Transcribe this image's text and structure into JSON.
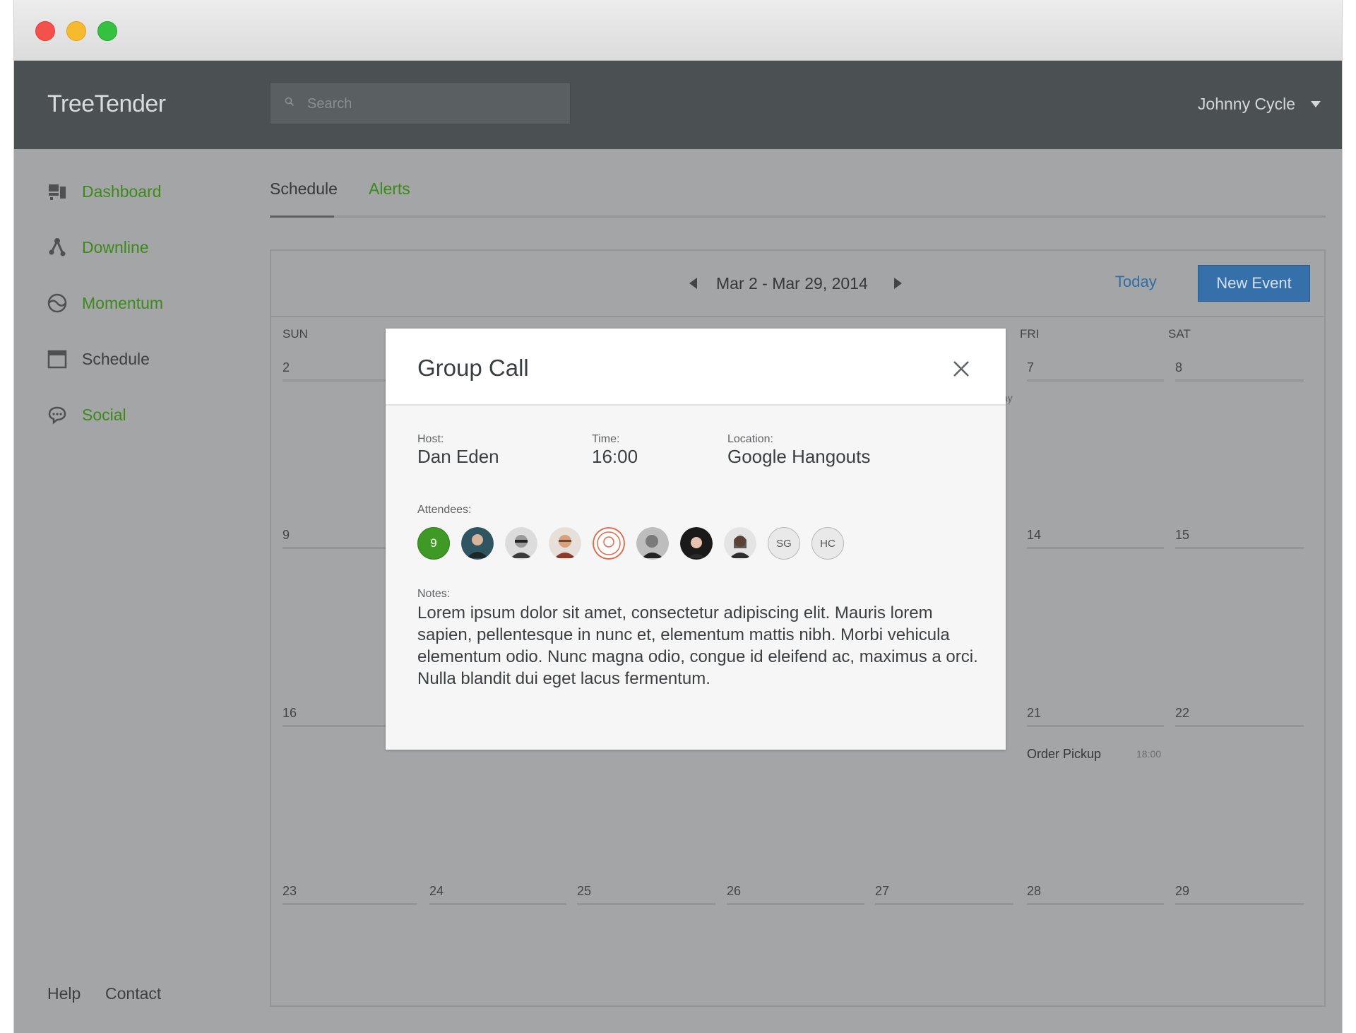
{
  "brand": "TreeTender",
  "search": {
    "placeholder": "Search"
  },
  "user": {
    "name": "Johnny Cycle"
  },
  "sidebar": {
    "items": [
      {
        "label": "Dashboard",
        "icon": "dashboard-icon"
      },
      {
        "label": "Downline",
        "icon": "downline-icon"
      },
      {
        "label": "Momentum",
        "icon": "momentum-icon"
      },
      {
        "label": "Schedule",
        "icon": "calendar-icon",
        "active": true
      },
      {
        "label": "Social",
        "icon": "chat-bubble-icon"
      }
    ],
    "footer": {
      "help": "Help",
      "contact": "Contact"
    }
  },
  "tabs": [
    {
      "label": "Schedule",
      "active": true
    },
    {
      "label": "Alerts",
      "active": false
    }
  ],
  "calendar": {
    "range": "Mar 2 - Mar 29, 2014",
    "today": "Today",
    "new_event": "New Event",
    "days_of_week": [
      "SUN",
      "FRI",
      "SAT"
    ],
    "weeks": [
      [
        "2",
        "7",
        "8"
      ],
      [
        "9",
        "14",
        "15"
      ],
      [
        "16",
        "21",
        "22"
      ],
      [
        "23",
        "24",
        "25",
        "26",
        "27",
        "28",
        "29"
      ]
    ],
    "fragment_text": "l day",
    "event": {
      "title": "Order Pickup",
      "time": "18:00"
    }
  },
  "modal": {
    "title": "Group Call",
    "host_label": "Host:",
    "host": "Dan Eden",
    "time_label": "Time:",
    "time": "16:00",
    "location_label": "Location:",
    "location": "Google Hangouts",
    "attendees_label": "Attendees:",
    "attendee_count": "9",
    "attendee_initials": [
      "SG",
      "HC"
    ],
    "notes_label": "Notes:",
    "notes": "Lorem ipsum dolor sit amet, consectetur adipiscing elit. Mauris lorem sapien, pellentesque in nunc et, elementum mattis nibh. Morbi vehicula elementum odio. Nunc magna odio, congue id eleifend ac, maximus a orci. Nulla blandit dui eget lacus fermentum."
  },
  "colors": {
    "accent_green": "#3b8a1a",
    "primary_blue": "#3670aa",
    "header_dark": "#4b5052",
    "overlay": "#a4a5a6"
  }
}
